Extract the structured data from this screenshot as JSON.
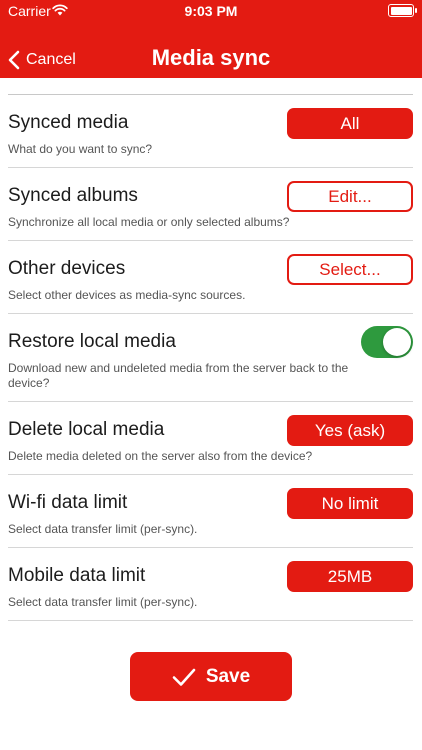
{
  "status_bar": {
    "carrier": "Carrier",
    "time": "9:03 PM"
  },
  "nav": {
    "back_label": "Cancel",
    "title": "Media sync"
  },
  "colors": {
    "accent": "#e31b12",
    "toggle_on": "#2e9a3e"
  },
  "settings": [
    {
      "title": "Synced media",
      "description": "What do you want to sync?",
      "control": "pill-filled",
      "value": "All"
    },
    {
      "title": "Synced albums",
      "description": "Synchronize all local media or only selected albums?",
      "control": "pill-outline",
      "value": "Edit..."
    },
    {
      "title": "Other devices",
      "description": "Select other devices as media-sync sources.",
      "control": "pill-outline",
      "value": "Select..."
    },
    {
      "title": "Restore local media",
      "description": "Download new and undeleted media from the server back to the device?",
      "control": "toggle",
      "value": "on"
    },
    {
      "title": "Delete local media",
      "description": "Delete media deleted on the server also from the device?",
      "control": "pill-filled",
      "value": "Yes (ask)"
    },
    {
      "title": "Wi-fi data limit",
      "description": "Select data transfer limit (per-sync).",
      "control": "pill-filled",
      "value": "No limit"
    },
    {
      "title": "Mobile data limit",
      "description": "Select data transfer limit (per-sync).",
      "control": "pill-filled",
      "value": "25MB"
    }
  ],
  "save": {
    "label": "Save",
    "icon": "checkmark-icon"
  }
}
